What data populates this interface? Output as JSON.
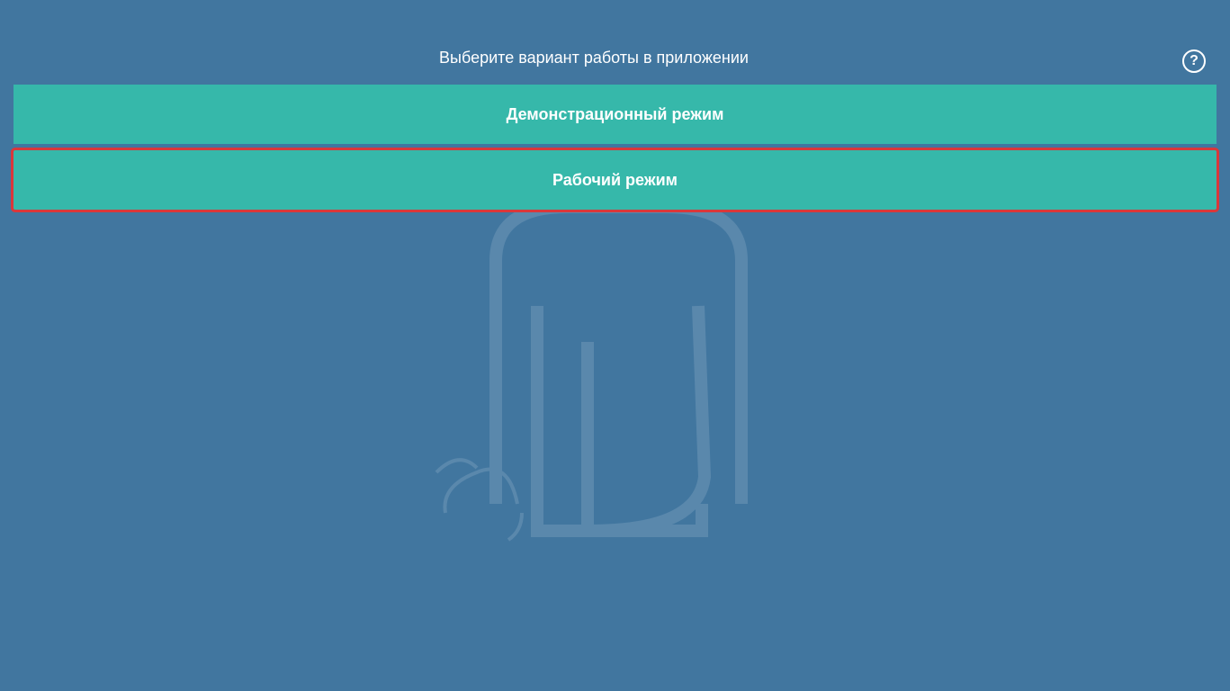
{
  "header": {
    "title": "Выберите вариант работы в приложении",
    "help_label": "?"
  },
  "modes": {
    "demo_label": "Демонстрационный режим",
    "work_label": "Рабочий режим"
  },
  "colors": {
    "background": "#41769f",
    "button": "#36b8aa",
    "focus_outline": "#d9383a"
  }
}
